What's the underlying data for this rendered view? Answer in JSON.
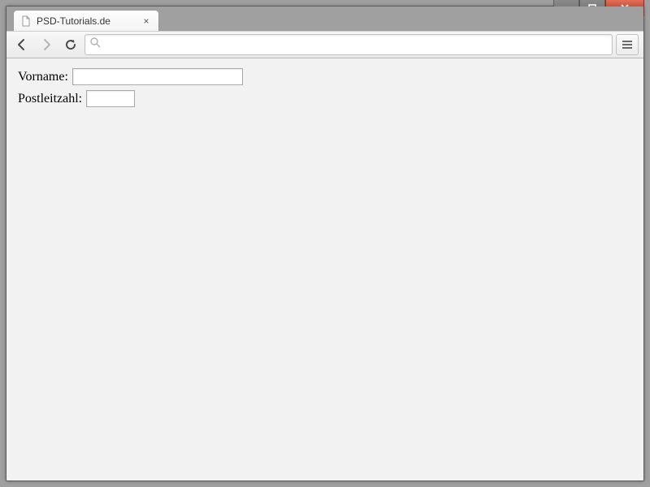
{
  "tab": {
    "title": "PSD-Tutorials.de"
  },
  "form": {
    "vorname_label": "Vorname:",
    "vorname_value": "",
    "plz_label": "Postleitzahl:",
    "plz_value": ""
  }
}
